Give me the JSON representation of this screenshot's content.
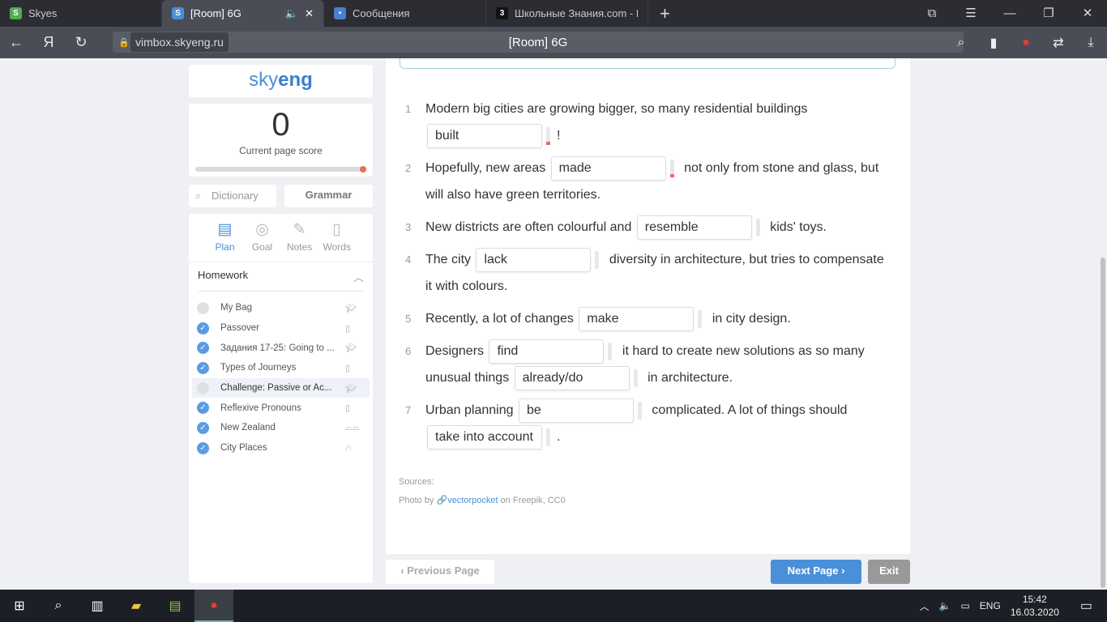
{
  "browser": {
    "tabs": [
      {
        "label": "Skyes",
        "favicon": "S",
        "color": "#4caf50",
        "active": false
      },
      {
        "label": "[Room] 6G",
        "favicon": "S",
        "color": "#4a90d9",
        "active": true
      },
      {
        "label": "Сообщения",
        "favicon": "chat-icon",
        "color": "#4a7fd0",
        "active": false
      },
      {
        "label": "Школьные Знания.com - Р",
        "favicon": "3",
        "color": "#111111",
        "active": false
      }
    ],
    "url_host": "vimbox.skyeng.ru",
    "page_title": "[Room] 6G",
    "yandex": "Я"
  },
  "sidebar": {
    "logo": {
      "a": "sky",
      "b": "eng"
    },
    "score": "0",
    "score_label": "Current page score",
    "score_progress": 1.0,
    "dictionary_placeholder": "Dictionary",
    "grammar_label": "Grammar",
    "plan_tabs": [
      {
        "label": "Plan",
        "icon": "plan-icon",
        "active": true
      },
      {
        "label": "Goal",
        "icon": "target-icon"
      },
      {
        "label": "Notes",
        "icon": "pencil-icon"
      },
      {
        "label": "Words",
        "icon": "book-icon"
      }
    ],
    "section": "Homework",
    "items": [
      {
        "name": "My Bag",
        "done": false,
        "type": "graduation-cap-icon"
      },
      {
        "name": "Passover",
        "done": true,
        "type": "book-icon"
      },
      {
        "name": "Задания 17-25: Going to ...",
        "done": true,
        "type": "graduation-cap-icon"
      },
      {
        "name": "Types of Journeys",
        "done": true,
        "type": "book-icon"
      },
      {
        "name": "Challenge: Passive or Ac...",
        "done": false,
        "type": "graduation-cap-icon",
        "selected": true
      },
      {
        "name": "Reflexive Pronouns",
        "done": true,
        "type": "book-icon"
      },
      {
        "name": "New Zealand",
        "done": true,
        "type": "glasses-icon"
      },
      {
        "name": "City Places",
        "done": true,
        "type": "headphones-icon"
      }
    ]
  },
  "exercise": [
    {
      "n": "1",
      "parts": [
        "Modern big cities are growing bigger, so many residential buildings ",
        {
          "gap": "built",
          "err": true
        },
        "!"
      ]
    },
    {
      "n": "2",
      "parts": [
        "Hopefully, new areas ",
        {
          "gap": "made",
          "err": true
        },
        " not only from stone and glass, but will also have green territories."
      ]
    },
    {
      "n": "3",
      "parts": [
        "New districts are often colourful and ",
        {
          "gap": "resemble"
        },
        " kids' toys."
      ]
    },
    {
      "n": "4",
      "parts": [
        "The city ",
        {
          "gap": "lack"
        },
        " diversity in architecture, but tries to compensate it with colours."
      ]
    },
    {
      "n": "5",
      "parts": [
        "Recently, a lot of changes ",
        {
          "gap": "make"
        },
        " in city design."
      ]
    },
    {
      "n": "6",
      "parts": [
        "Designers ",
        {
          "gap": "find"
        },
        " it hard to create new solutions as so many unusual things ",
        {
          "gap": "already/do"
        },
        " in architecture."
      ]
    },
    {
      "n": "7",
      "parts": [
        "Urban planning ",
        {
          "gap": "be"
        },
        " complicated. A lot of things should ",
        {
          "gap": "take into account"
        },
        "."
      ]
    }
  ],
  "sources": {
    "label": "Sources:",
    "prefix": "Photo by ",
    "author": "vectorpocket",
    "suffix": " on Freepik, CC0"
  },
  "footer": {
    "prev": "Previous Page",
    "next": "Next Page",
    "exit": "Exit"
  },
  "taskbar": {
    "lang": "ENG",
    "time": "15:42",
    "date": "16.03.2020"
  },
  "colors": {
    "accent": "#4a90d9",
    "error": "#f06a5e"
  }
}
